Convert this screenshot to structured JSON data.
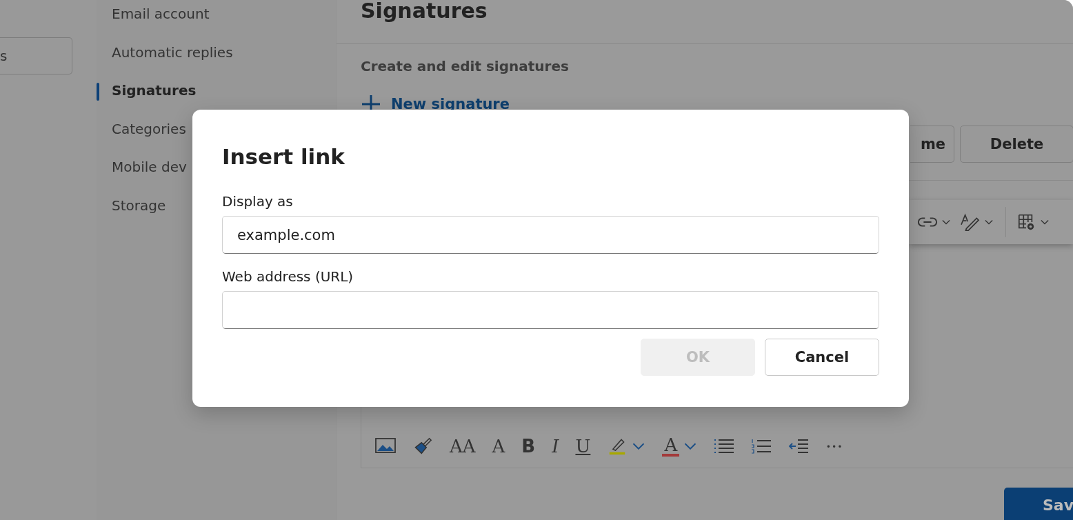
{
  "search_field": {
    "value": "s"
  },
  "nav": {
    "items": [
      {
        "label": "Email account",
        "selected": false
      },
      {
        "label": "Automatic replies",
        "selected": false
      },
      {
        "label": "Signatures",
        "selected": true
      },
      {
        "label": "Categories",
        "selected": false
      },
      {
        "label": "Mobile dev",
        "selected": false
      },
      {
        "label": "Storage",
        "selected": false
      }
    ]
  },
  "main": {
    "title": "Signatures",
    "subtitle": "Create and edit signatures",
    "new_button": "New signature",
    "buttons": [
      {
        "label": "me"
      },
      {
        "label": "Delete"
      }
    ],
    "top_toolbar": [
      {
        "kind": "link"
      },
      {
        "kind": "format"
      },
      {
        "kind": "table"
      }
    ],
    "format_toolbar": [
      {
        "kind": "image"
      },
      {
        "kind": "brush"
      },
      {
        "kind": "glyph",
        "glyph": "AA"
      },
      {
        "kind": "glyph",
        "glyph": "A"
      },
      {
        "kind": "bold",
        "glyph": "B"
      },
      {
        "kind": "italic",
        "glyph": "I"
      },
      {
        "kind": "underline",
        "glyph": "U"
      },
      {
        "kind": "highlight",
        "color": "#a8a800"
      },
      {
        "kind": "color",
        "glyph": "A",
        "color": "#a33a3a"
      },
      {
        "kind": "bullets"
      },
      {
        "kind": "numbers"
      },
      {
        "kind": "outdent"
      },
      {
        "kind": "glyph",
        "glyph": "···"
      }
    ],
    "save_button": "Sav"
  },
  "dialog": {
    "title": "Insert link",
    "fields": [
      {
        "label": "Display as",
        "value": "example.com"
      },
      {
        "label": "Web address (URL)"
      }
    ],
    "buttons": [
      {
        "label": "OK",
        "disabled": true
      },
      {
        "label": "Cancel",
        "disabled": false
      }
    ]
  }
}
